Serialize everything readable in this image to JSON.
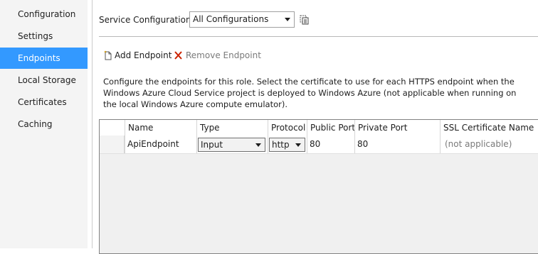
{
  "nav": {
    "items": [
      {
        "label": "Configuration",
        "selected": false
      },
      {
        "label": "Settings",
        "selected": false
      },
      {
        "label": "Endpoints",
        "selected": true
      },
      {
        "label": "Local Storage",
        "selected": false
      },
      {
        "label": "Certificates",
        "selected": false
      },
      {
        "label": "Caching",
        "selected": false
      }
    ]
  },
  "header": {
    "service_config_label": "Service Configuration:",
    "service_config_value": "All Configurations",
    "copy_icon": "copy-config-icon"
  },
  "toolbar": {
    "add_label": "Add Endpoint",
    "remove_label": "Remove Endpoint",
    "add_icon": "new-document-icon",
    "remove_icon": "red-x-icon"
  },
  "description": "Configure the endpoints for this role.  Select the certificate to use for each HTTPS endpoint when the Windows Azure Cloud Service project is deployed to Windows Azure (not applicable when running on the local Windows Azure compute emulator).",
  "grid": {
    "columns": [
      "Name",
      "Type",
      "Protocol",
      "Public Port",
      "Private Port",
      "SSL Certificate Name"
    ],
    "rows": [
      {
        "name": "ApiEndpoint",
        "type": "Input",
        "protocol": "http",
        "public_port": "80",
        "private_port": "80",
        "ssl_certificate": "(not applicable)"
      }
    ]
  },
  "colors": {
    "selected_nav_bg": "#3399ff",
    "nav_bg": "#f4f4f4",
    "remove_x": "#cc2200"
  }
}
